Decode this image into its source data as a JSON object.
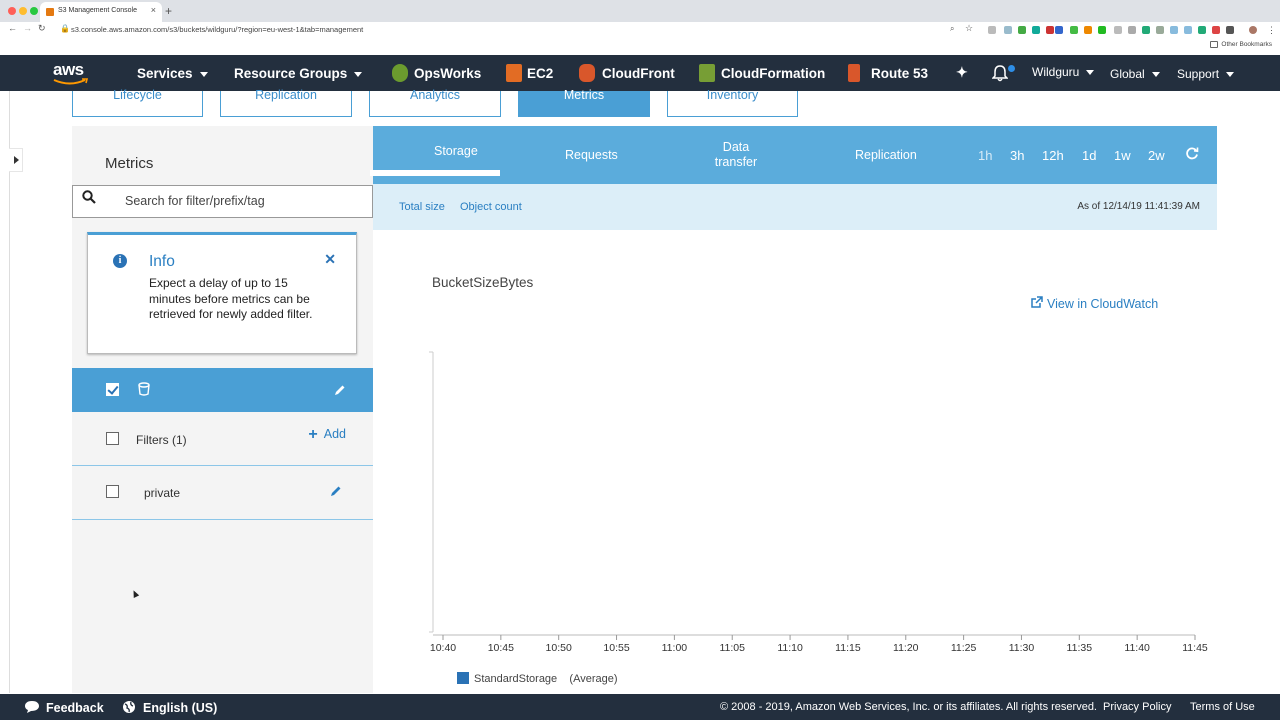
{
  "browser": {
    "tab_title": "S3 Management Console",
    "url": "s3.console.aws.amazon.com/s3/buckets/wildguru/?region=eu-west-1&tab=management",
    "bookmarks_label": "Other Bookmarks"
  },
  "nav": {
    "logo_text": "aws",
    "services": "Services",
    "resource_groups": "Resource Groups",
    "shortcuts": [
      "OpsWorks",
      "EC2",
      "CloudFront",
      "CloudFormation",
      "Route 53"
    ],
    "user": "Wildguru",
    "region": "Global",
    "support": "Support"
  },
  "management_tabs": [
    {
      "label": "Lifecycle",
      "active": false
    },
    {
      "label": "Replication",
      "active": false
    },
    {
      "label": "Analytics",
      "active": false
    },
    {
      "label": "Metrics",
      "active": true
    },
    {
      "label": "Inventory",
      "active": false
    }
  ],
  "left_panel": {
    "title": "Metrics",
    "search_placeholder": "Search for filter/prefix/tag",
    "info": {
      "title": "Info",
      "text": "Expect a delay of up to 15 minutes before metrics can be retrieved for newly added filter."
    },
    "filters_label": "Filters (1)",
    "add_label": "Add",
    "filters": [
      {
        "label": "private"
      }
    ]
  },
  "metric_tabs": [
    "Storage",
    "Requests",
    "Data transfer",
    "Replication"
  ],
  "time_ranges": [
    "1h",
    "3h",
    "12h",
    "1d",
    "1w",
    "2w"
  ],
  "metric_links": [
    "Total size",
    "Object count"
  ],
  "as_of": "As of 12/14/19 11:41:39 AM",
  "chart_title": "BucketSizeBytes",
  "cloudwatch_link": "View in CloudWatch",
  "chart_data": {
    "type": "line",
    "title": "BucketSizeBytes",
    "x": [
      "10:40",
      "10:45",
      "10:50",
      "10:55",
      "11:00",
      "11:05",
      "11:10",
      "11:15",
      "11:20",
      "11:25",
      "11:30",
      "11:35",
      "11:40",
      "11:45"
    ],
    "series": [
      {
        "name": "StandardStorage",
        "values": []
      }
    ],
    "legend_suffix": "(Average)",
    "legend": "bottom-left",
    "grid": false
  },
  "colors": {
    "aws_nav": "#232f3e",
    "accent_blue": "#4a9fd5",
    "series_blue": "#2a72b5"
  },
  "footer": {
    "feedback": "Feedback",
    "language": "English (US)",
    "copyright": "© 2008 - 2019, Amazon Web Services, Inc. or its affiliates. All rights reserved.",
    "privacy": "Privacy Policy",
    "terms": "Terms of Use"
  }
}
